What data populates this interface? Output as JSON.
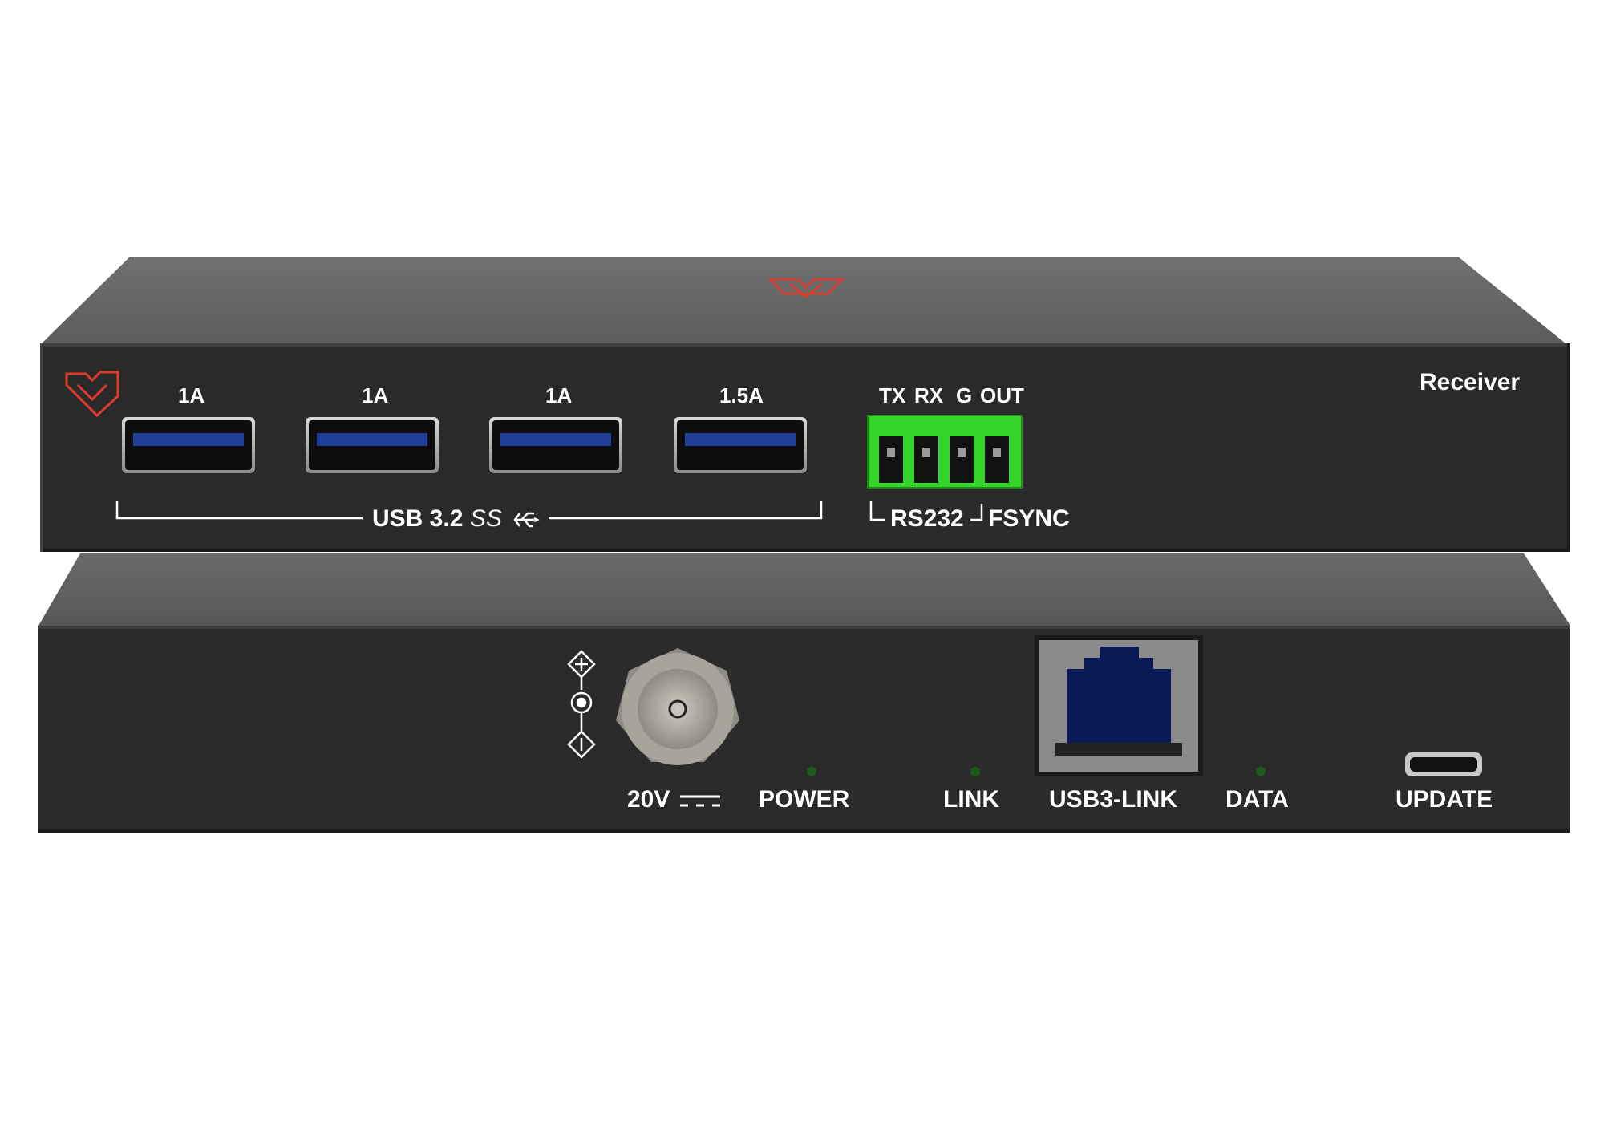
{
  "top_unit": {
    "model_label": "Receiver",
    "usb_ports": [
      {
        "current": "1A"
      },
      {
        "current": "1A"
      },
      {
        "current": "1A"
      },
      {
        "current": "1.5A"
      }
    ],
    "usb_group_label": "USB 3.2",
    "terminal_pins": [
      "TX",
      "RX",
      "G",
      "OUT"
    ],
    "rs232_label": "RS232",
    "fsync_label": "FSYNC"
  },
  "bottom_unit": {
    "power_input_label": "20V",
    "indicators": {
      "power": "POWER",
      "link": "LINK",
      "data": "DATA"
    },
    "rj45_label": "USB3-LINK",
    "update_label": "UPDATE"
  },
  "colors": {
    "chassis_front": "#2b2b2b",
    "chassis_top": "#6d6d6d",
    "usb_blue": "#1f3f9a",
    "terminal_green": "#35d42a",
    "logo_red": "#e23a2a",
    "rj45_insert": "#0a1a55",
    "led_green": "#1c5a1c"
  }
}
